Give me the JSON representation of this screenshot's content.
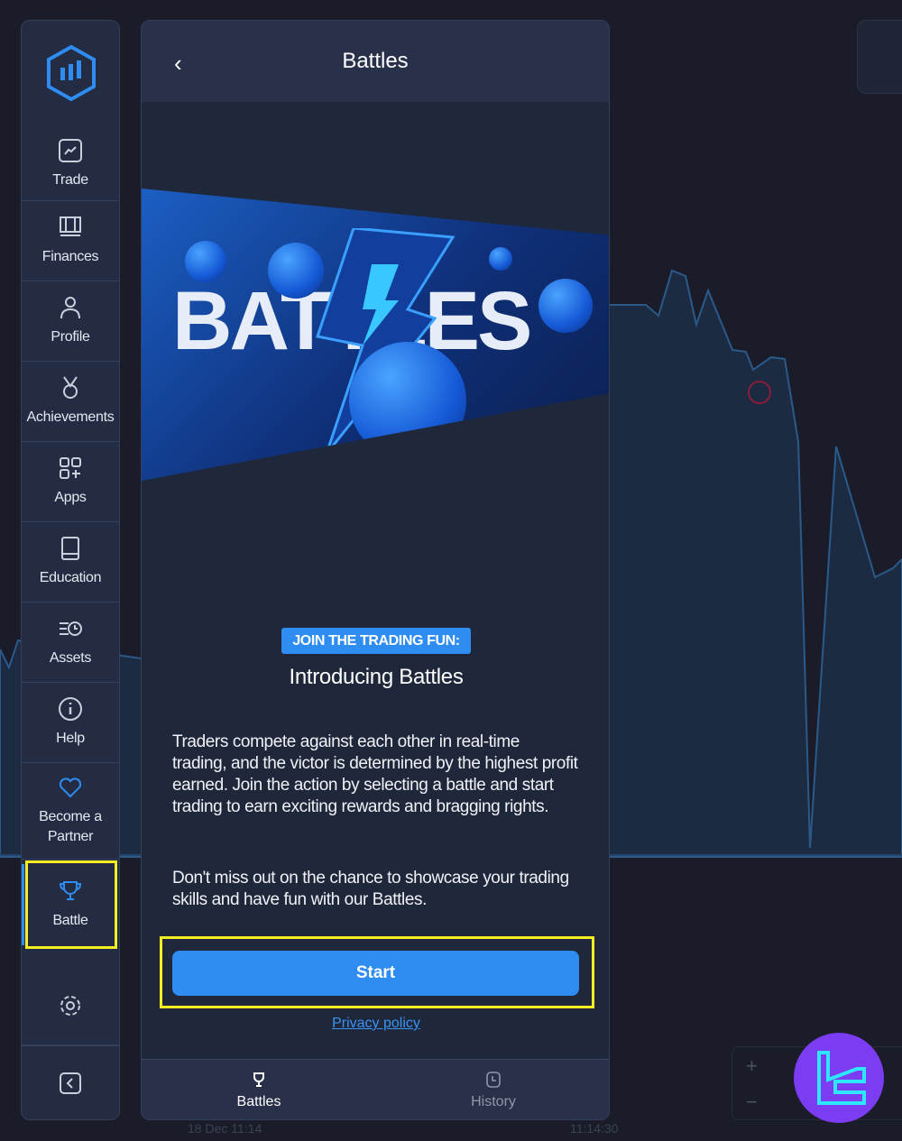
{
  "sidebar": {
    "items": [
      {
        "label": "Trade",
        "icon": "chart-line-icon"
      },
      {
        "label": "Finances",
        "icon": "wallet-icon"
      },
      {
        "label": "Profile",
        "icon": "user-icon"
      },
      {
        "label": "Achievements",
        "icon": "medal-icon"
      },
      {
        "label": "Apps",
        "icon": "apps-icon"
      },
      {
        "label": "Education",
        "icon": "book-icon"
      },
      {
        "label": "Assets",
        "icon": "assets-icon"
      },
      {
        "label": "Help",
        "icon": "info-icon"
      },
      {
        "label": "Become a Partner",
        "icon": "heart-icon"
      },
      {
        "label": "Battle",
        "icon": "trophy-icon",
        "active": true
      }
    ],
    "settings_icon": "gear-icon",
    "collapse_icon": "chevron-left-icon"
  },
  "panel": {
    "title": "Battles",
    "banner_text": "BATTLES",
    "badge": "JOIN THE TRADING FUN:",
    "heading": "Introducing Battles",
    "paragraph1": "Traders compete against each other in real-time trading, and the victor is determined by the highest profit earned. Join the action by selecting a battle and start trading to earn exciting rewards and bragging rights.",
    "paragraph2": "Don't miss out on the chance to showcase your trading skills and have fun with our Battles.",
    "start_label": "Start",
    "privacy_label": "Privacy policy",
    "tabs": [
      {
        "label": "Battles",
        "icon": "trophy-icon",
        "active": true
      },
      {
        "label": "History",
        "icon": "clock-icon"
      }
    ]
  },
  "chart": {
    "time_labels": [
      "18 Dec 11:14",
      "11:14:30"
    ],
    "zoom_in": "+",
    "zoom_out": "−"
  },
  "colors": {
    "accent": "#2f8cf0",
    "highlight": "#f5ee21",
    "sidebar": "#232c42",
    "background": "#1a1d29",
    "brand": "#7b3cf2"
  }
}
